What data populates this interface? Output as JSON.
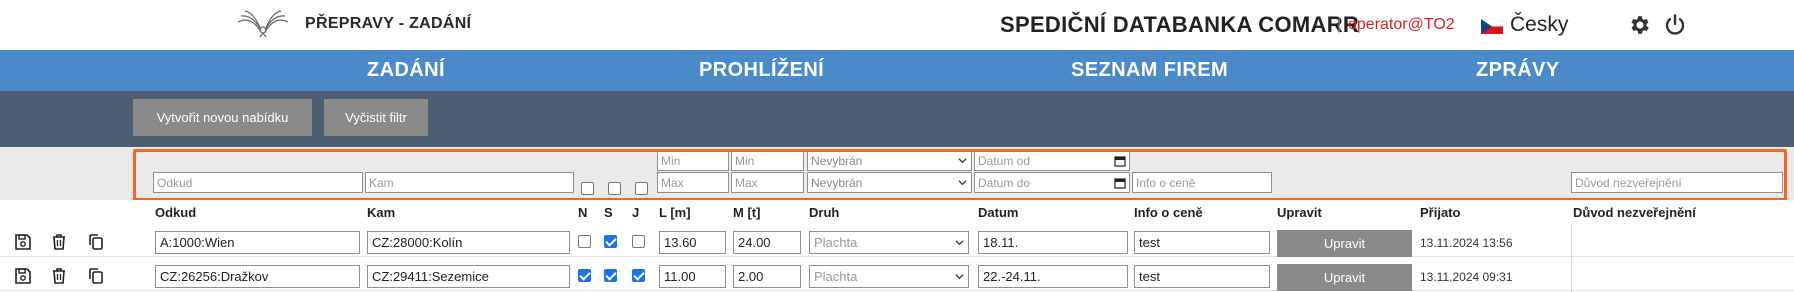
{
  "header": {
    "page_title": "PŘEPRAVY - ZADÁNÍ",
    "app_title": "SPEDIČNÍ DATABANKA COMARR",
    "separator": "|",
    "user": "operator@TO2",
    "language": "Česky"
  },
  "nav": {
    "items": [
      {
        "label": "ZADÁNÍ"
      },
      {
        "label": "PROHLÍŽENÍ"
      },
      {
        "label": "SEZNAM FIREM"
      },
      {
        "label": "ZPRÁVY"
      }
    ]
  },
  "toolbar": {
    "new_offer": "Vytvořit novou nabídku",
    "clear_filter": "Vyčistit filtr"
  },
  "filters": {
    "from_placeholder": "Odkud",
    "to_placeholder": "Kam",
    "l_min_placeholder": "Min",
    "l_max_placeholder": "Max",
    "m_min_placeholder": "Min",
    "m_max_placeholder": "Max",
    "type_top": "Nevybrán",
    "type_bottom": "Nevybrán",
    "date_from_placeholder": "Datum od",
    "date_to_placeholder": "Datum do",
    "price_placeholder": "Info o ceně",
    "reason_placeholder": "Důvod nezveřejnění"
  },
  "columns": {
    "from": "Odkud",
    "to": "Kam",
    "n": "N",
    "s": "S",
    "j": "J",
    "length": "L [m]",
    "mass": "M [t]",
    "type": "Druh",
    "date": "Datum",
    "price": "Info o ceně",
    "edit": "Upravit",
    "received": "Přijato",
    "reason": "Důvod nezveřejnění"
  },
  "rows": [
    {
      "from": "A:1000:Wien",
      "to": "CZ:28000:Kolín",
      "n": false,
      "s": true,
      "j": false,
      "length": "13.60",
      "mass": "24.00",
      "type": "Plachta",
      "date": "18.11.",
      "price": "test",
      "edit_label": "Upravit",
      "received": "13.11.2024 13:56",
      "reason": ""
    },
    {
      "from": "CZ:26256:Dražkov",
      "to": "CZ:29411:Sezemice",
      "n": true,
      "s": true,
      "j": true,
      "length": "11.00",
      "mass": "2.00",
      "type": "Plachta",
      "date": "22.-24.11.",
      "price": "test",
      "edit_label": "Upravit",
      "received": "13.11.2024 09:31",
      "reason": ""
    }
  ],
  "icons": {
    "logo": "winged-logo-icon",
    "settings": "gear-icon",
    "logout": "power-icon",
    "flag": "czech-flag-icon",
    "save": "save-icon",
    "delete": "trash-icon",
    "copy": "copy-icon"
  },
  "colors": {
    "nav": "#4a8ac9",
    "toolbar": "#4c5e6f",
    "highlight": "#f26522",
    "user": "#e02020",
    "button": "#8a8a8a",
    "checkbox": "#1a73e8"
  }
}
